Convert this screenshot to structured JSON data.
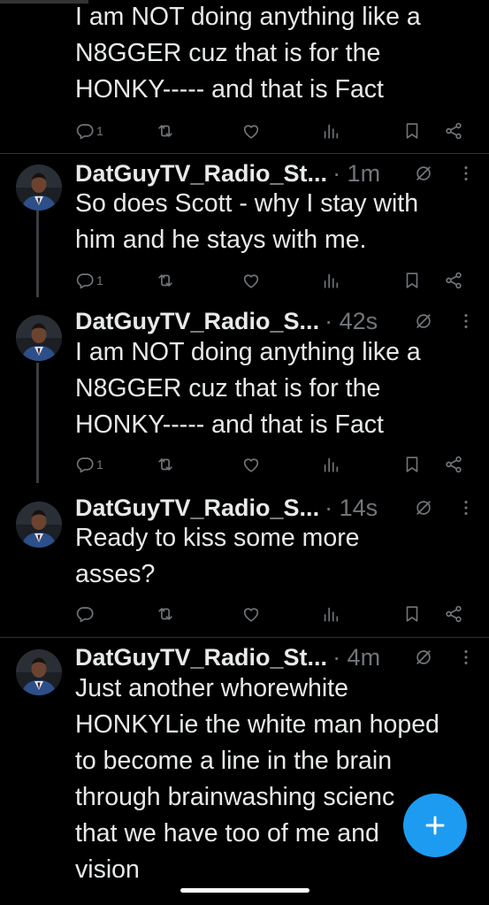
{
  "tweets": [
    {
      "body": "I am NOT doing anything like a\nN8GGER cuz that is for the\nHONKY----- and that is Fact",
      "reply_count": "1"
    },
    {
      "name": "DatGuyTV_Radio_St...",
      "time": "· 1m",
      "body": "So does Scott - why I stay with\nhim and he stays with me.",
      "reply_count": "1"
    },
    {
      "name": "DatGuyTV_Radio_S...",
      "time": "· 42s",
      "body": "I am NOT doing anything like a\nN8GGER cuz that is for the\nHONKY----- and that is Fact",
      "reply_count": "1"
    },
    {
      "name": "DatGuyTV_Radio_S...",
      "time": "· 14s",
      "body": "Ready to kiss some more\nasses?",
      "reply_count": ""
    },
    {
      "name": "DatGuyTV_Radio_St...",
      "time": "· 4m",
      "body": "Just another whorewhite\nHONKYLie the white man hoped\nto become a line in the brain\nthrough brainwashing scienc\nthat we have too of me and\nvision"
    }
  ],
  "icons": {
    "reply": "reply-icon",
    "retweet": "retweet-icon",
    "like": "like-icon",
    "views": "views-icon",
    "bookmark": "bookmark-icon",
    "share": "share-icon",
    "grok": "grok-icon",
    "more": "more-icon",
    "compose": "compose-plus-icon"
  },
  "colors": {
    "background": "#000000",
    "text": "#e7e9ea",
    "secondary": "#71767b",
    "accent": "#1d9bf0"
  }
}
